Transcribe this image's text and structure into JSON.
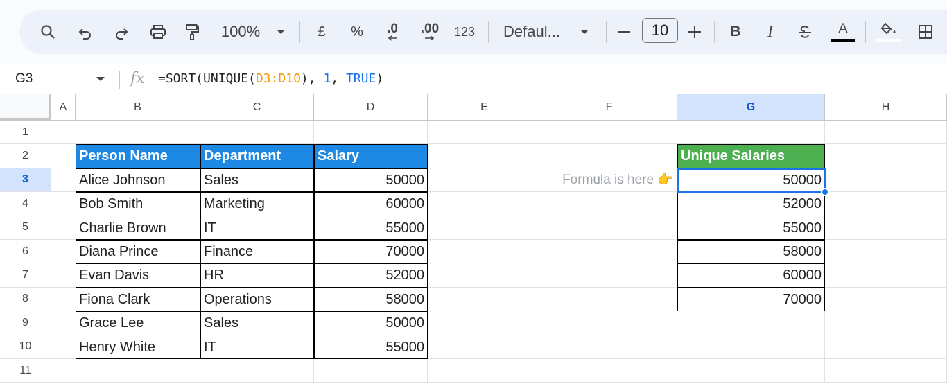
{
  "toolbar": {
    "zoom": "100%",
    "currency": "£",
    "percent": "%",
    "decrease_decimals": ".0",
    "increase_decimals": ".00",
    "number_format": "123",
    "font": "Defaul...",
    "font_size": "10",
    "text_color_underline": "#000000",
    "fill_color_underline": "#ffffff"
  },
  "formula_bar": {
    "name_box": "G3",
    "fx": "fx",
    "formula_prefix": "=SORT(UNIQUE(",
    "formula_range": "D3:D10",
    "formula_mid": "), ",
    "formula_arg1": "1",
    "formula_comma": ", ",
    "formula_arg2": "TRUE",
    "formula_suffix": ")"
  },
  "columns": [
    "A",
    "B",
    "C",
    "D",
    "E",
    "F",
    "G",
    "H"
  ],
  "selected_column": "G",
  "rows": [
    "1",
    "2",
    "3",
    "4",
    "5",
    "6",
    "7",
    "8",
    "9",
    "10",
    "11"
  ],
  "selected_row": "3",
  "table": {
    "headers": [
      "Person Name",
      "Department",
      "Salary"
    ],
    "header_color": "#1e88e5",
    "rows": [
      [
        "Alice Johnson",
        "Sales",
        "50000"
      ],
      [
        "Bob Smith",
        "Marketing",
        "60000"
      ],
      [
        "Charlie Brown",
        "IT",
        "55000"
      ],
      [
        "Diana Prince",
        "Finance",
        "70000"
      ],
      [
        "Evan Davis",
        "HR",
        "52000"
      ],
      [
        "Fiona Clark",
        "Operations",
        "58000"
      ],
      [
        "Grace Lee",
        "Sales",
        "50000"
      ],
      [
        "Henry White",
        "IT",
        "55000"
      ]
    ]
  },
  "note": "Formula is here 👉",
  "unique": {
    "header": "Unique Salaries",
    "header_color": "#4caf50",
    "values": [
      "50000",
      "52000",
      "55000",
      "58000",
      "60000",
      "70000"
    ]
  }
}
